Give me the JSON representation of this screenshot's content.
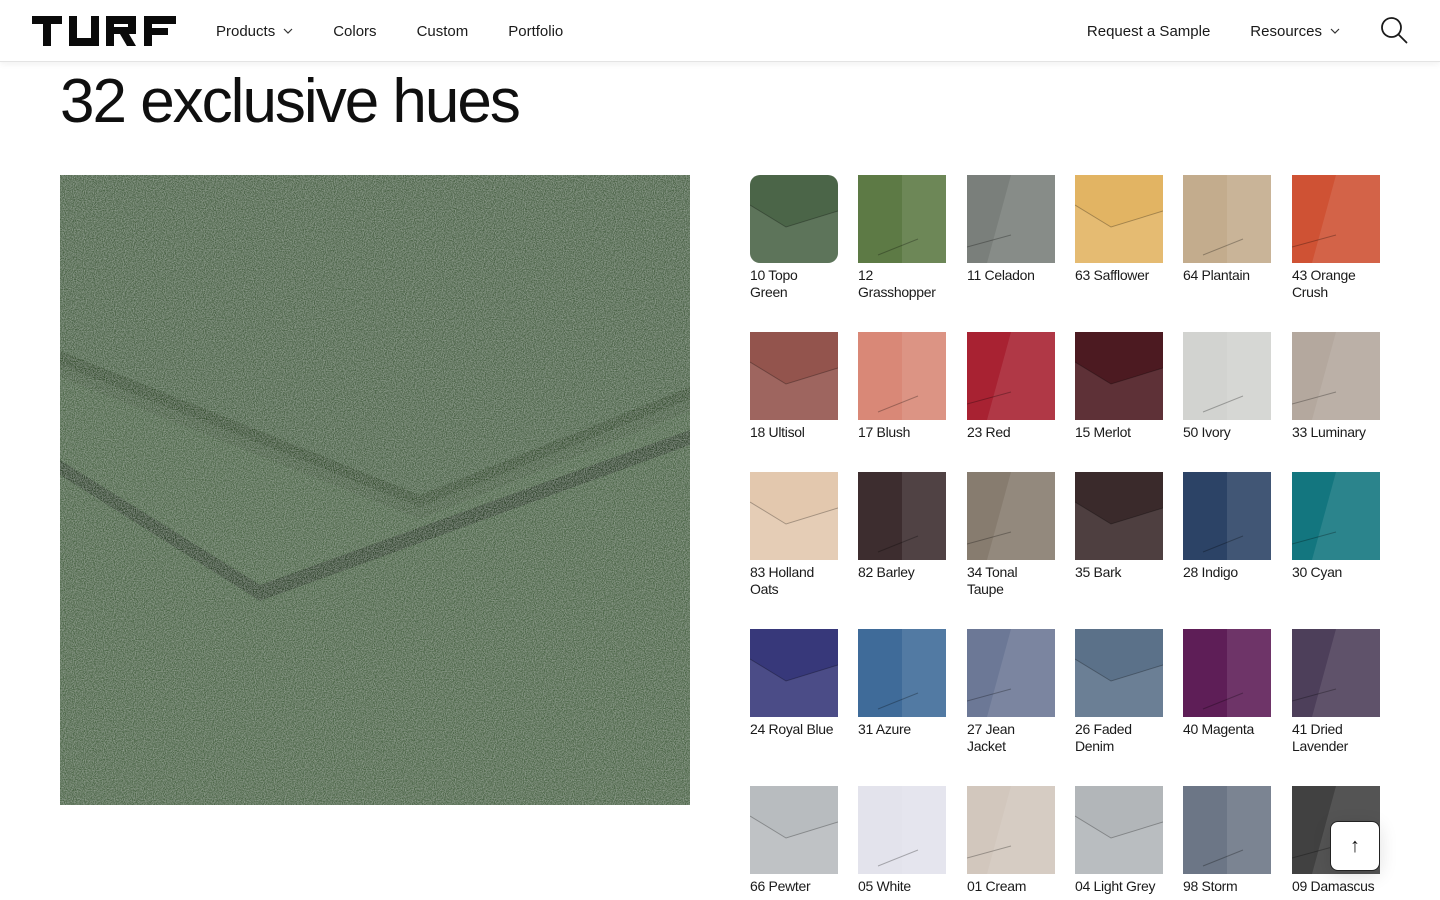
{
  "brand": {
    "name": "TURF"
  },
  "nav": {
    "left": [
      {
        "label": "Products",
        "dropdown": true
      },
      {
        "label": "Colors",
        "dropdown": false
      },
      {
        "label": "Custom",
        "dropdown": false
      },
      {
        "label": "Portfolio",
        "dropdown": false
      }
    ],
    "right": [
      {
        "label": "Request a Sample",
        "dropdown": false
      },
      {
        "label": "Resources",
        "dropdown": true
      }
    ],
    "search_icon": "search-icon"
  },
  "page_title": "32 exclusive hues",
  "hero": {
    "color": "#4a6347",
    "selected": "10 Topo Green"
  },
  "swatches": [
    {
      "label": "10 Topo Green",
      "color": "#4b6548",
      "selected": true
    },
    {
      "label": "12 Grasshopper",
      "color": "#5d7a45"
    },
    {
      "label": "11 Celadon",
      "color": "#7a7f7b"
    },
    {
      "label": "63 Safflower",
      "color": "#e2b463"
    },
    {
      "label": "64 Plantain",
      "color": "#c3ac8d"
    },
    {
      "label": "43 Orange Crush",
      "color": "#cf5234"
    },
    {
      "label": "18 Ultisol",
      "color": "#93544d"
    },
    {
      "label": "17 Blush",
      "color": "#d98877"
    },
    {
      "label": "23 Red",
      "color": "#a82232"
    },
    {
      "label": "15 Merlot",
      "color": "#4c1a21"
    },
    {
      "label": "50 Ivory",
      "color": "#d2d3d0"
    },
    {
      "label": "33 Luminary",
      "color": "#b4a89e"
    },
    {
      "label": "83 Holland Oats",
      "color": "#e3c8ae"
    },
    {
      "label": "82 Barley",
      "color": "#3d2d2f"
    },
    {
      "label": "34 Tonal Taupe",
      "color": "#877c6f"
    },
    {
      "label": "35 Bark",
      "color": "#3a2a2b"
    },
    {
      "label": "28 Indigo",
      "color": "#2c4366"
    },
    {
      "label": "30 Cyan",
      "color": "#13767f"
    },
    {
      "label": "24 Royal Blue",
      "color": "#37387a"
    },
    {
      "label": "31 Azure",
      "color": "#3f6b99"
    },
    {
      "label": "27 Jean Jacket",
      "color": "#6c7896"
    },
    {
      "label": "26 Faded Denim",
      "color": "#5b7189"
    },
    {
      "label": "40 Magenta",
      "color": "#5e1e57"
    },
    {
      "label": "41 Dried Lavender",
      "color": "#4d3f5a"
    },
    {
      "label": "66 Pewter",
      "color": "#b8bcbf"
    },
    {
      "label": "05 White",
      "color": "#e3e3ec"
    },
    {
      "label": "01 Cream",
      "color": "#d2c7bd"
    },
    {
      "label": "04 Light Grey",
      "color": "#b2b6b9"
    },
    {
      "label": "98 Storm",
      "color": "#6c7686"
    },
    {
      "label": "09 Damascus",
      "color": "#414141"
    }
  ],
  "back_to_top": {
    "icon": "arrow-up-icon",
    "glyph": "↑"
  }
}
